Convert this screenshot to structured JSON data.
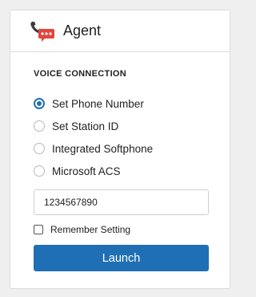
{
  "header": {
    "title": "Agent",
    "icon": "phone-chat-icon"
  },
  "voice_connection": {
    "section_title": "VOICE CONNECTION",
    "options": [
      {
        "label": "Set Phone Number",
        "selected": true
      },
      {
        "label": "Set Station ID",
        "selected": false
      },
      {
        "label": "Integrated Softphone",
        "selected": false
      },
      {
        "label": "Microsoft ACS",
        "selected": false
      }
    ],
    "phone_number_value": "1234567890",
    "remember_label": "Remember Setting",
    "remember_checked": false,
    "launch_label": "Launch"
  },
  "colors": {
    "accent": "#1f6fb5",
    "icon_red": "#e0463c",
    "icon_dark": "#3a3a3a"
  }
}
